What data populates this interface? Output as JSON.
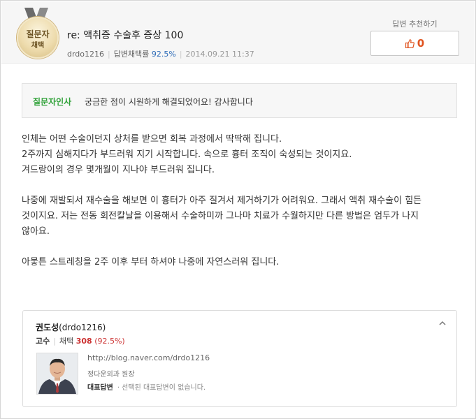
{
  "header": {
    "medal": {
      "line1": "질문자",
      "line2": "채택"
    },
    "title_prefix": "re:",
    "title": "액취증 수술후 증상 100",
    "author_id": "drdo1216",
    "adoption_label": "답변채택률",
    "adoption_rate": "92.5%",
    "datetime": "2014.09.21 11:37",
    "recommend_label": "답변 추천하기",
    "recommend_count": "0"
  },
  "greeting": {
    "label": "질문자인사",
    "text": "궁금한 점이 시원하게 해결되었어요! 감사합니다"
  },
  "answer": {
    "p1": [
      "인체는 어떤 수술이던지 상처를 받으면 회복 과정에서 딱딱해 집니다.",
      "2주까지 심해지다가 부드러워 지기 시작합니다. 속으로 흉터 조직이 숙성되는 것이지요.",
      "겨드랑이의 경우 몇개월이 지나야 부드러워 집니다."
    ],
    "p2": [
      "나중에 재발되서 재수술을 해보면 이 흉터가 아주 질겨서 제거하기가 어려워요. 그래서 액취 재수술이 힘든",
      "것이지요. 저는 전동 회전칼날을 이용해서 수술하미까 그나마 치료가 수월하지만 다른 방법은 엄두가 나지",
      "않아요."
    ],
    "p3": [
      "아뭏튼 스트레칭을 2주 이후 부터 하셔야 나중에 자연스러워 집니다."
    ]
  },
  "profile": {
    "name": "권도성",
    "handle": "(drdo1216)",
    "grade": "고수",
    "adopt_label": "채택",
    "adopt_count": "308",
    "adopt_pct": "(92.5%)",
    "blog_url": "http://blog.naver.com/drdo1216",
    "clinic": "정다운외과 원장",
    "rep_label": "대표답변",
    "rep_text": "· 선택된 대표답변이 없습니다."
  },
  "colors": {
    "accent_green": "#31a23a",
    "rate_blue": "#2e6cb8",
    "recommend_orange": "#e0531f",
    "adopt_red": "#cc3333"
  }
}
